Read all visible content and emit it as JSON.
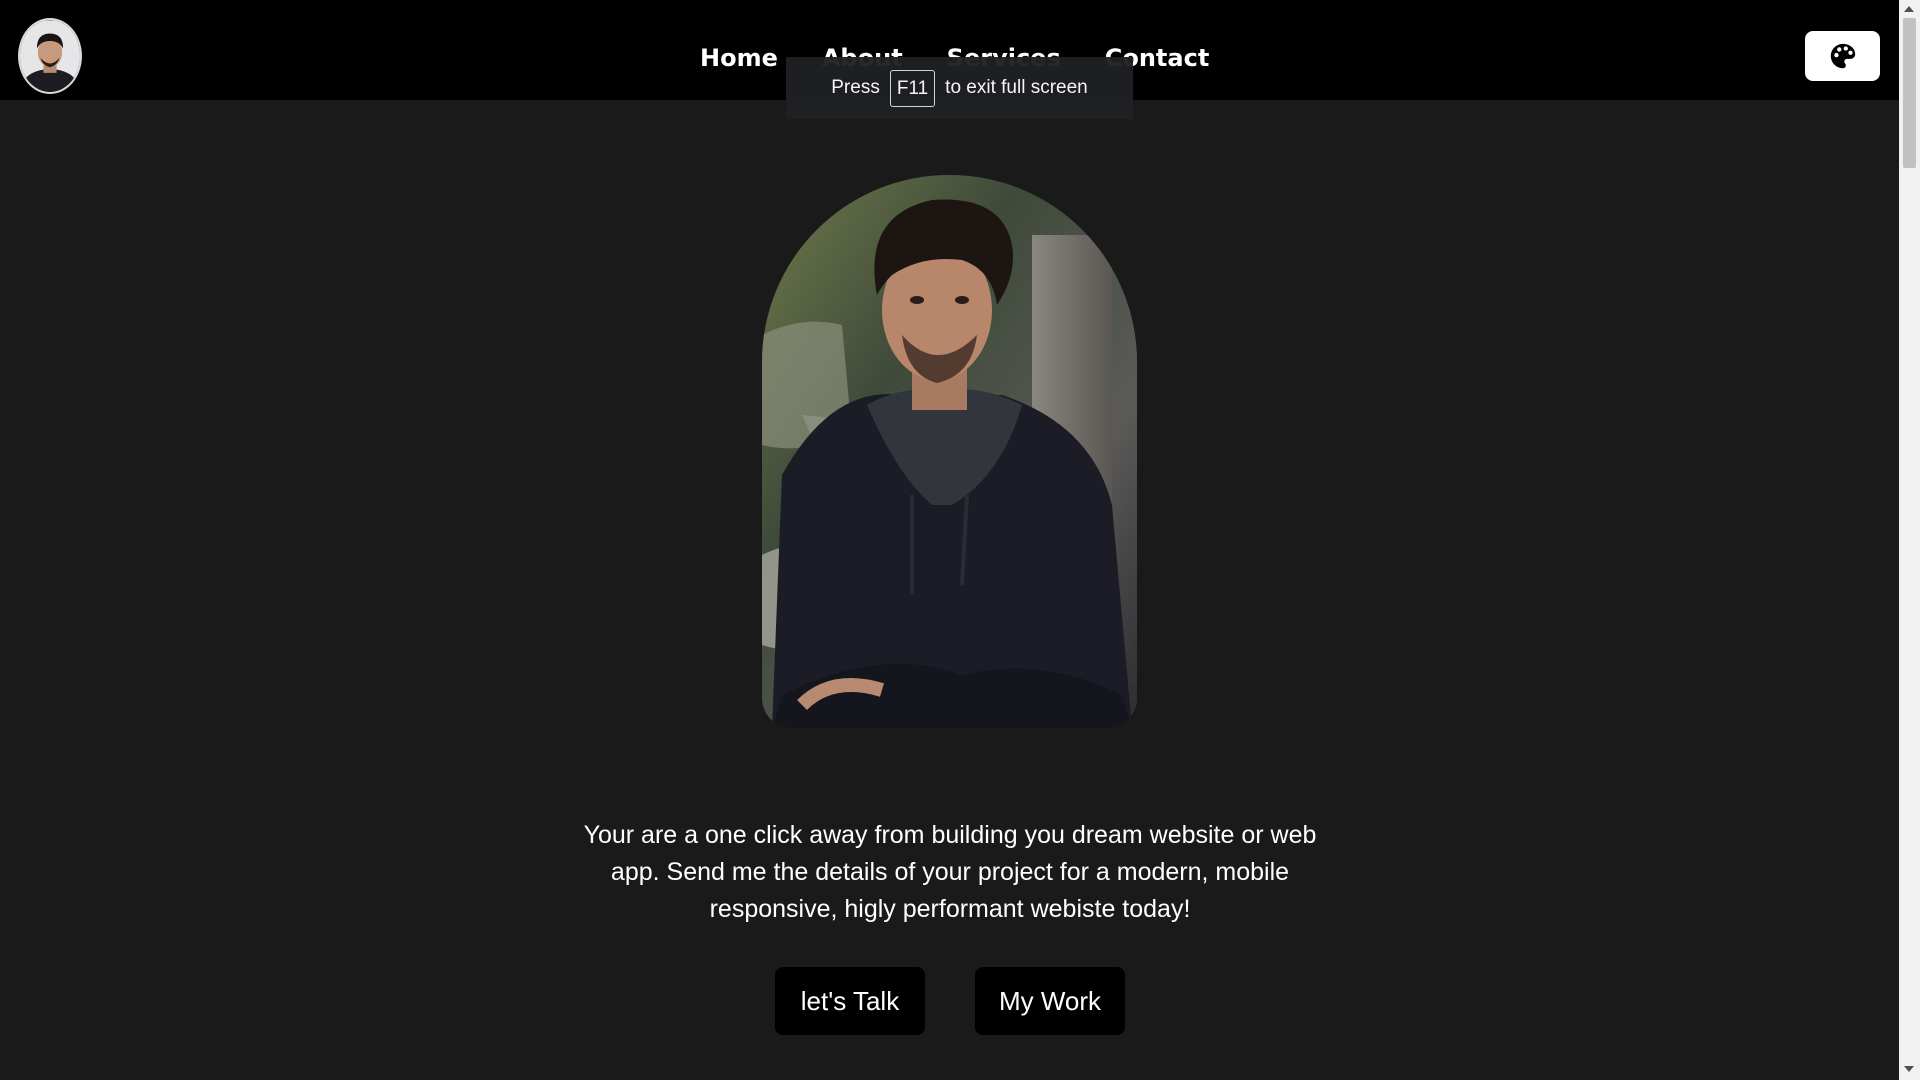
{
  "nav": {
    "links": [
      "Home",
      "About",
      "Services",
      "Contact"
    ]
  },
  "theme_button": {
    "icon": "palette-icon"
  },
  "fullscreen_notice": {
    "prefix": "Press",
    "key": "F11",
    "suffix": "to exit full screen"
  },
  "hero": {
    "intro": "Your are a one click away from building you dream website or web app. Send me the details of your project for a modern, mobile responsive, higly performant webiste today!"
  },
  "buttons": {
    "talk": "let's Talk",
    "work": "My Work"
  },
  "colors": {
    "page_background": "#1a1a1a",
    "navbar_background": "#000000",
    "button_background": "#000000",
    "text": "#ffffff"
  }
}
